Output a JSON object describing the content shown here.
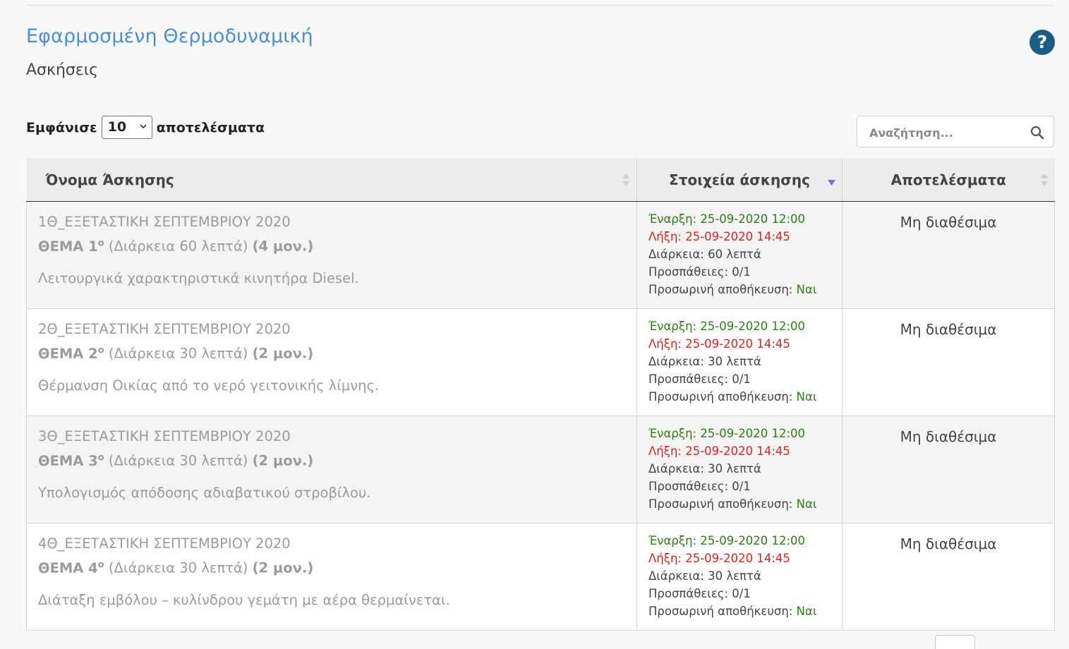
{
  "page": {
    "title": "Εφαρμοσμένη Θερμοδυναμική",
    "subtitle": "Ασκήσεις"
  },
  "help": {
    "icon": "question-circle-icon",
    "label": "?"
  },
  "controls": {
    "length_prefix": "Εμφάνισε",
    "length_value": "10",
    "length_suffix": "αποτελέσματα",
    "search_placeholder": "Αναζήτηση..."
  },
  "table": {
    "headers": {
      "name": "Όνομα Άσκησης",
      "details": "Στοιχεία άσκησης",
      "results": "Αποτελέσματα"
    },
    "rows": [
      {
        "title": "1Θ_ΕΞΕΤΑΣΤΙΚΗ ΣΕΠΤΕΜΒΡΙΟΥ 2020",
        "topic": "ΘΕΜΑ 1",
        "topic_sup": "ο",
        "duration_note": "(Διάρκεια 60 λεπτά)",
        "points": "(4 μον.)",
        "description": "Λειτουργικά χαρακτηριστικά κινητήρα Diesel.",
        "start": "Έναρξη: 25-09-2020 12:00",
        "end": "Λήξη: 25-09-2020 14:45",
        "duration": "Διάρκεια: 60 λεπτά",
        "attempts": "Προσπάθειες: 0/1",
        "temp_save_label": "Προσωρινή αποθήκευση:",
        "temp_save_value": "Ναι",
        "results": "Μη διαθέσιμα"
      },
      {
        "title": "2Θ_ΕΞΕΤΑΣΤΙΚΗ ΣΕΠΤΕΜΒΡΙΟΥ 2020",
        "topic": "ΘΕΜΑ 2",
        "topic_sup": "ο",
        "duration_note": "(Διάρκεια 30 λεπτά)",
        "points": "(2 μον.)",
        "description": "Θέρμανση Οικίας από το νερό γειτονικής λίμνης.",
        "start": "Έναρξη: 25-09-2020 12:00",
        "end": "Λήξη: 25-09-2020 14:45",
        "duration": "Διάρκεια: 30 λεπτά",
        "attempts": "Προσπάθειες: 0/1",
        "temp_save_label": "Προσωρινή αποθήκευση:",
        "temp_save_value": "Ναι",
        "results": "Μη διαθέσιμα"
      },
      {
        "title": "3Θ_ΕΞΕΤΑΣΤΙΚΗ ΣΕΠΤΕΜΒΡΙΟΥ 2020",
        "topic": "ΘΕΜΑ 3",
        "topic_sup": "ο",
        "duration_note": "(Διάρκεια 30 λεπτά)",
        "points": "(2 μον.)",
        "description": "Υπολογισμός απόδοσης αδιαβατικού στροβίλου.",
        "start": "Έναρξη: 25-09-2020 12:00",
        "end": "Λήξη: 25-09-2020 14:45",
        "duration": "Διάρκεια: 30 λεπτά",
        "attempts": "Προσπάθειες: 0/1",
        "temp_save_label": "Προσωρινή αποθήκευση:",
        "temp_save_value": "Ναι",
        "results": "Μη διαθέσιμα"
      },
      {
        "title": "4Θ_ΕΞΕΤΑΣΤΙΚΗ ΣΕΠΤΕΜΒΡΙΟΥ 2020",
        "topic": "ΘΕΜΑ 4",
        "topic_sup": "ο",
        "duration_note": "(Διάρκεια 30 λεπτά)",
        "points": "(2 μον.)",
        "description": "Διάταξη εμβόλου – κυλίνδρου γεμάτη με αέρα θερμαίνεται.",
        "start": "Έναρξη: 25-09-2020 12:00",
        "end": "Λήξη: 25-09-2020 14:45",
        "duration": "Διάρκεια: 30 λεπτά",
        "attempts": "Προσπάθειες: 0/1",
        "temp_save_label": "Προσωρινή αποθήκευση:",
        "temp_save_value": "Ναι",
        "results": "Μη διαθέσιμα"
      }
    ]
  },
  "colors": {
    "title_blue": "#4a8fd6",
    "help_icon": "#1b5d85",
    "start_green": "#2e7d17",
    "end_red": "#e0241c",
    "sort_active": "#6b6fe0"
  }
}
